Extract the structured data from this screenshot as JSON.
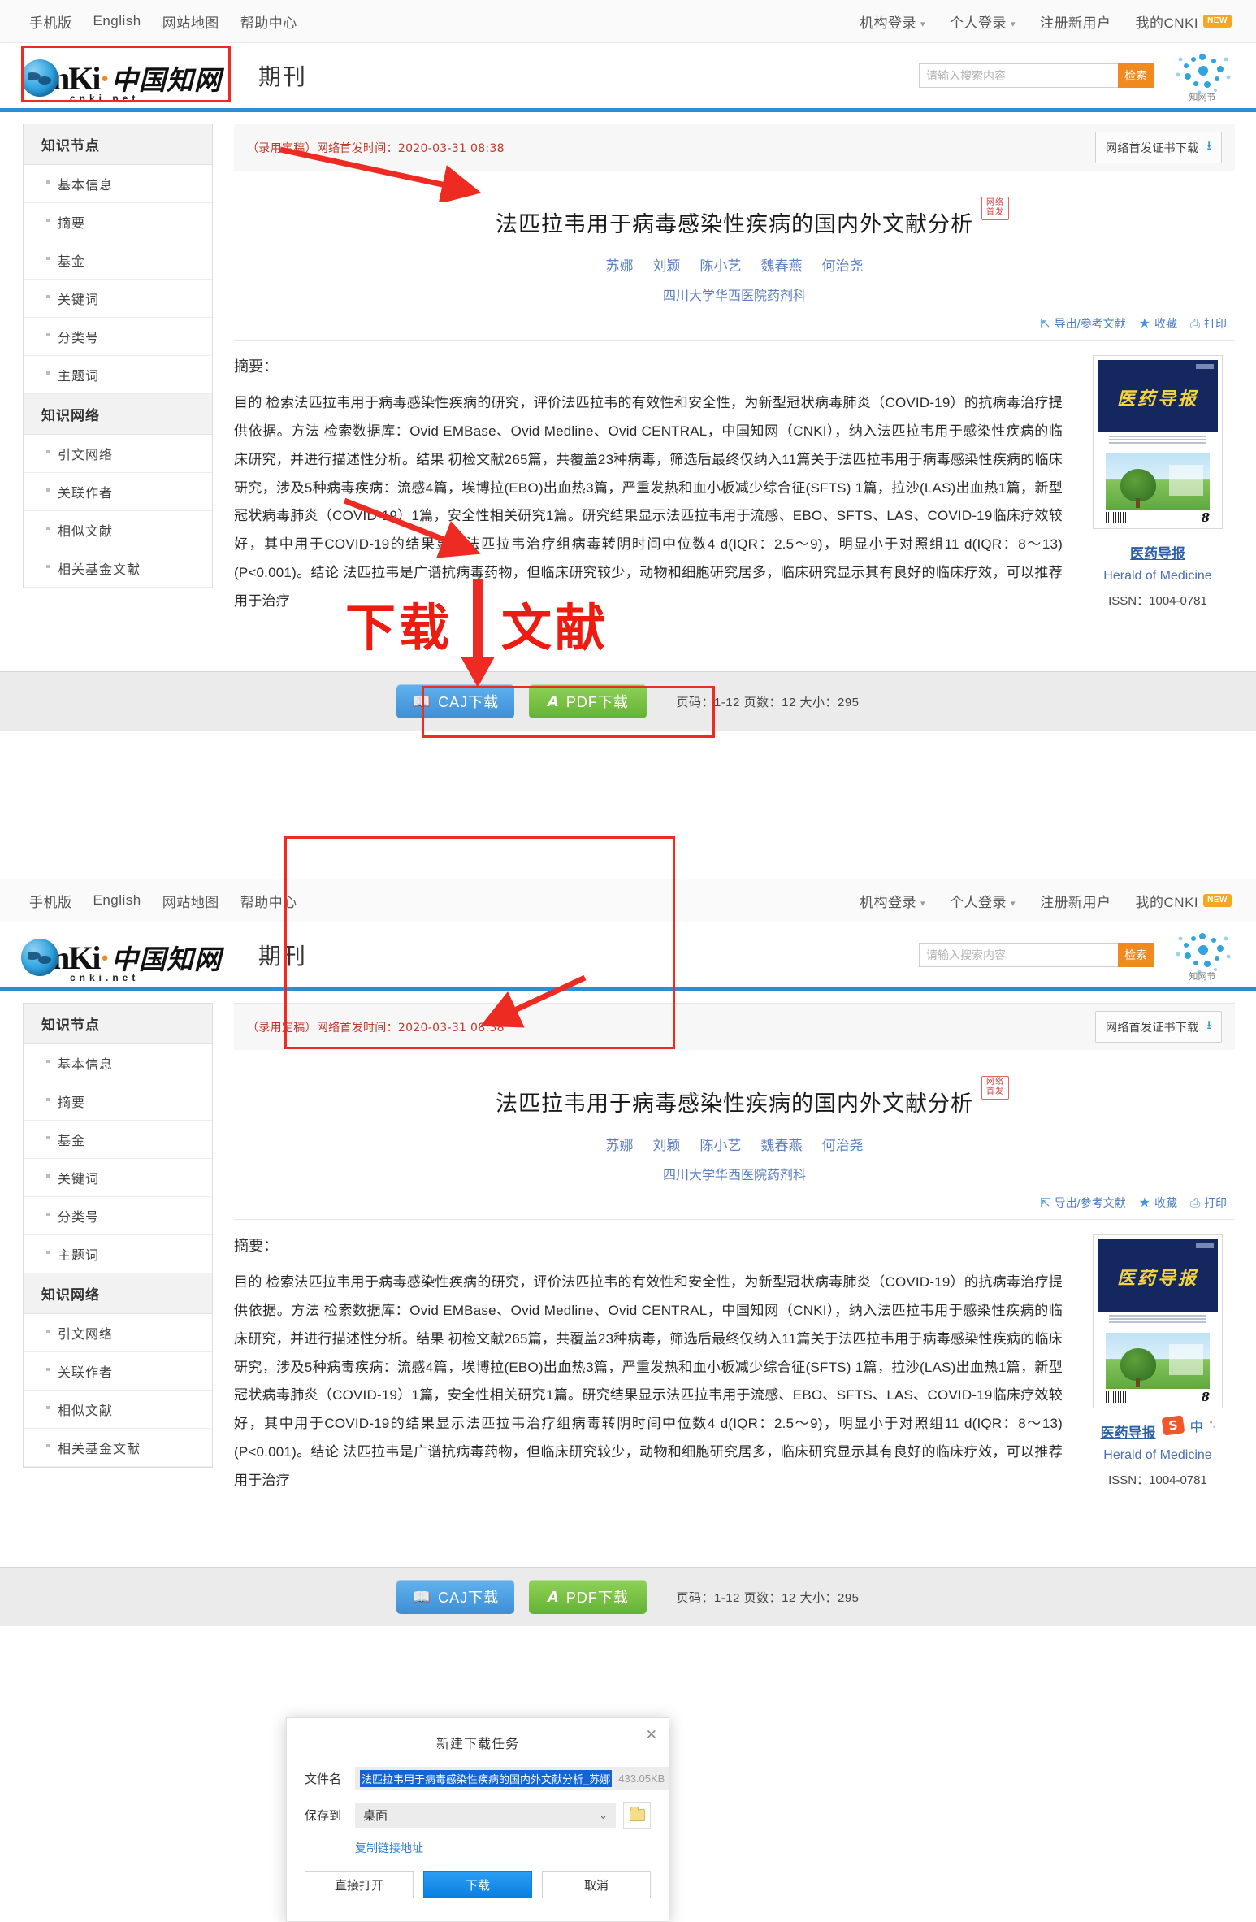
{
  "topnav": {
    "left_links": [
      "手机版",
      "English",
      "网站地图",
      "帮助中心"
    ],
    "right_links": [
      {
        "label": "机构登录",
        "caret": true,
        "badge": ""
      },
      {
        "label": "个人登录",
        "caret": true,
        "badge": ""
      },
      {
        "label": "注册新用户",
        "caret": false,
        "badge": ""
      },
      {
        "label": "我的CNKI",
        "caret": false,
        "badge": "NEW"
      }
    ]
  },
  "brand": {
    "wordmark": "nKi",
    "wordmark_cn": "中国知网",
    "domain": "cnki.net",
    "channel": "期刊",
    "festival_label": "知网节"
  },
  "search": {
    "placeholder": "请输入搜索内容",
    "value": "",
    "button": "检索"
  },
  "sidebar": {
    "groups": [
      {
        "title": "知识节点",
        "items": [
          "基本信息",
          "摘要",
          "基金",
          "关键词",
          "分类号",
          "主题词"
        ]
      },
      {
        "title": "知识网络",
        "items": [
          "引文网络",
          "关联作者",
          "相似文献",
          "相关基金文献"
        ]
      }
    ]
  },
  "article": {
    "first_publish_note": "（录用定稿）网络首发时间：2020-03-31  08:38",
    "cert_button": "网络首发证书下载",
    "title": "法匹拉韦用于病毒感染性疾病的国内外文献分析",
    "first_publish_badge": "网络\n首发",
    "first_publish_badge_line1": "网络",
    "first_publish_badge_line2": "首发",
    "authors": [
      "苏娜",
      "刘颖",
      "陈小艺",
      "魏春燕",
      "何治尧"
    ],
    "affiliation": "四川大学华西医院药剂科",
    "tools": [
      {
        "label": "导出/参考文献",
        "icon": "export-icon"
      },
      {
        "label": "收藏",
        "icon": "star-icon"
      },
      {
        "label": "打印",
        "icon": "print-icon"
      }
    ],
    "abstract_label": "摘要：",
    "abstract": "目的 检索法匹拉韦用于病毒感染性疾病的研究，评价法匹拉韦的有效性和安全性，为新型冠状病毒肺炎（COVID-19）的抗病毒治疗提供依据。方法 检索数据库：Ovid EMBase、Ovid Medline、Ovid CENTRAL，中国知网（CNKI），纳入法匹拉韦用于感染性疾病的临床研究，并进行描述性分析。结果 初检文献265篇，共覆盖23种病毒，筛选后最终仅纳入11篇关于法匹拉韦用于病毒感染性疾病的临床研究，涉及5种病毒疾病：流感4篇，埃博拉(EBO)出血热3篇，严重发热和血小板减少综合征(SFTS) 1篇，拉沙(LAS)出血热1篇，新型冠状病毒肺炎（COVID-19）1篇，安全性相关研究1篇。研究结果显示法匹拉韦用于流感、EBO、SFTS、LAS、COVID-19临床疗效较好，其中用于COVID-19的结果显示法匹拉韦治疗组病毒转阴时间中位数4 d(IQR：2.5～9)，明显小于对照组11 d(IQR：8～13)(P<0.001)。结论 法匹拉韦是广谱抗病毒药物，但临床研究较少，动物和细胞研究居多，临床研究显示其有良好的临床疗效，可以推荐用于治疗"
  },
  "journal": {
    "cover_title": "医药导报",
    "cover_issue": "8",
    "name": "医药导报",
    "name_en": "Herald of Medicine",
    "issn_label": "ISSN：1004-0781",
    "sogou_s": "S",
    "sogou_zhong": "中"
  },
  "download_bar": {
    "caj_label": "CAJ下载",
    "pdf_label": "PDF下载",
    "meta": "页码：1-12  页数：12  大小：295"
  },
  "annotation": {
    "big_text_left": "下载",
    "big_text_right": "文献"
  },
  "dialog": {
    "title": "新建下载任务",
    "close": "✕",
    "filename_label": "文件名",
    "filename_value": "法匹拉韦用于病毒感染性疾病的国内外文献分析_苏娜",
    "filesize": "433.05KB",
    "saveto_label": "保存到",
    "saveto_value": "桌面",
    "copy_link": "复制链接地址",
    "open_button": "直接打开",
    "download_button": "下载",
    "cancel_button": "取消"
  },
  "colors": {
    "accent_blue": "#2b8fd6",
    "accent_orange": "#f08a1e",
    "annotation_red": "#ee1b10",
    "pdf_green": "#65b233"
  }
}
